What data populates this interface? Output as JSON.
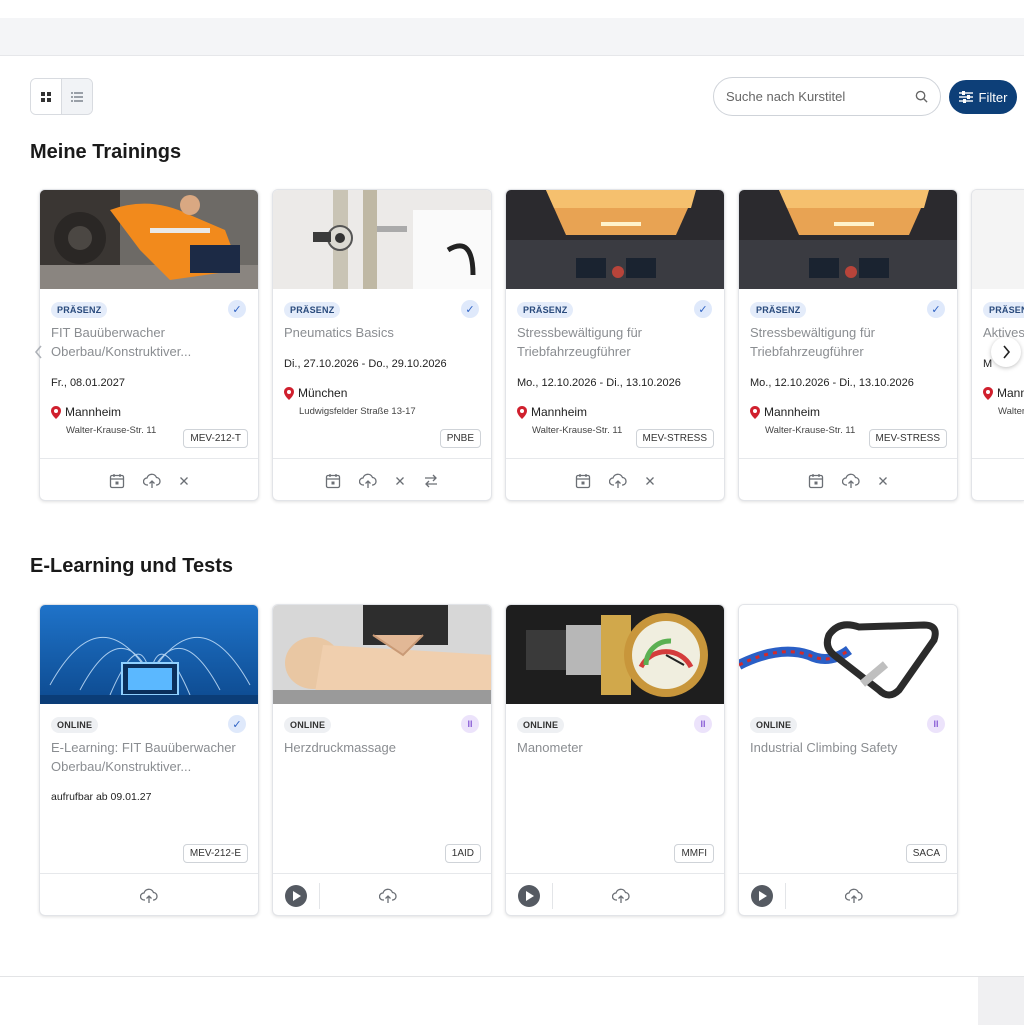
{
  "search": {
    "placeholder": "Suche nach Kurstitel"
  },
  "filter": {
    "label": "Filter"
  },
  "sections": {
    "trainings": {
      "title": "Meine Trainings",
      "cards": [
        {
          "badge": "PRÄSENZ",
          "title": "FIT Bauüberwacher Oberbau/Konstruktiver...",
          "date": "Fr., 08.01.2027",
          "city": "Mannheim",
          "address": "Walter-Krause-Str. 11",
          "code": "MEV-212-T"
        },
        {
          "badge": "PRÄSENZ",
          "title": "Pneumatics Basics",
          "date": "Di., 27.10.2026 - Do., 29.10.2026",
          "city": "München",
          "address": "Ludwigsfelder Straße 13-17",
          "code": "PNBE"
        },
        {
          "badge": "PRÄSENZ",
          "title": "Stressbewältigung für Triebfahrzeugführer",
          "date": "Mo., 12.10.2026 - Di., 13.10.2026",
          "city": "Mannheim",
          "address": "Walter-Krause-Str. 11",
          "code": "MEV-STRESS"
        },
        {
          "badge": "PRÄSENZ",
          "title": "Stressbewältigung für Triebfahrzeugführer",
          "date": "Mo., 12.10.2026 - Di., 13.10.2026",
          "city": "Mannheim",
          "address": "Walter-Krause-Str. 11",
          "code": "MEV-STRESS"
        },
        {
          "badge": "PRÄSEN",
          "title": "Aktives",
          "date": "M",
          "city": "Mann",
          "address": "Walter"
        }
      ]
    },
    "elearning": {
      "title": "E-Learning und Tests",
      "cards": [
        {
          "badge": "ONLINE",
          "title": "E-Learning: FIT Bauüberwacher Oberbau/Konstruktiver...",
          "note": "aufrufbar ab 09.01.27",
          "code": "MEV-212-E"
        },
        {
          "badge": "ONLINE",
          "title": "Herzdruckmassage",
          "code": "1AID"
        },
        {
          "badge": "ONLINE",
          "title": "Manometer",
          "code": "MMFI"
        },
        {
          "badge": "ONLINE",
          "title": "Industrial Climbing Safety",
          "code": "SACA"
        }
      ]
    }
  },
  "icons": {
    "grid_view": "grid-icon",
    "list_view": "list-icon",
    "search": "search-icon",
    "filter": "sliders-icon",
    "calendar": "calendar-icon",
    "upload": "cloud-upload-icon",
    "close": "close-icon",
    "swap": "swap-icon",
    "location": "map-pin-icon",
    "check": "check-icon",
    "pause": "pause-icon",
    "play": "play-icon",
    "prev": "chevron-left-icon",
    "next": "chevron-right-icon"
  },
  "colors": {
    "primary": "#0d3f78",
    "pin": "#d0202e",
    "check_bg": "#dfe9fb",
    "pause_bg": "#ece3fb"
  }
}
